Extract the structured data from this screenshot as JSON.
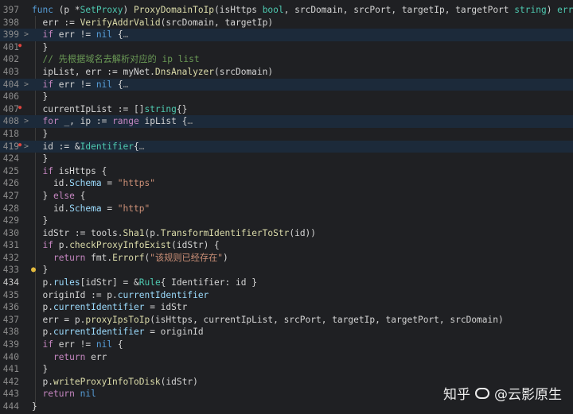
{
  "editor": {
    "lines": [
      {
        "num": "397",
        "fold": "",
        "segments": [
          {
            "t": "func",
            "c": "kw2"
          },
          {
            "t": " (p *",
            "c": "plain"
          },
          {
            "t": "SetProxy",
            "c": "ty"
          },
          {
            "t": ") ",
            "c": "plain"
          },
          {
            "t": "ProxyDomainToIp",
            "c": "fn"
          },
          {
            "t": "(isHttps ",
            "c": "plain"
          },
          {
            "t": "bool",
            "c": "ty"
          },
          {
            "t": ", srcDomain, srcPort, targetIp, targetPort ",
            "c": "plain"
          },
          {
            "t": "string",
            "c": "ty"
          },
          {
            "t": ") ",
            "c": "plain"
          },
          {
            "t": "error",
            "c": "ty"
          },
          {
            "t": " {",
            "c": "plain"
          }
        ]
      },
      {
        "num": "398",
        "fold": "",
        "segments": [
          {
            "t": "  err := ",
            "c": "plain"
          },
          {
            "t": "VerifyAddrValid",
            "c": "fn"
          },
          {
            "t": "(srcDomain, targetIp)",
            "c": "plain"
          }
        ]
      },
      {
        "num": "399",
        "fold": ">",
        "folded": true,
        "segments": [
          {
            "t": "  ",
            "c": "plain"
          },
          {
            "t": "if",
            "c": "kw"
          },
          {
            "t": " err != ",
            "c": "plain"
          },
          {
            "t": "nil",
            "c": "kw2"
          },
          {
            "t": " {",
            "c": "plain"
          },
          {
            "t": "…",
            "c": "fold-ell"
          }
        ]
      },
      {
        "num": "401",
        "fold": "",
        "marker": true,
        "segments": [
          {
            "t": "  }",
            "c": "plain"
          }
        ]
      },
      {
        "num": "402",
        "fold": "",
        "segments": [
          {
            "t": "  // 先根据域名去解析对应的 ip list",
            "c": "cm"
          }
        ]
      },
      {
        "num": "403",
        "fold": "",
        "segments": [
          {
            "t": "  ipList, err := myNet.",
            "c": "plain"
          },
          {
            "t": "DnsAnalyzer",
            "c": "fn"
          },
          {
            "t": "(srcDomain)",
            "c": "plain"
          }
        ]
      },
      {
        "num": "404",
        "fold": ">",
        "folded": true,
        "segments": [
          {
            "t": "  ",
            "c": "plain"
          },
          {
            "t": "if",
            "c": "kw"
          },
          {
            "t": " err != ",
            "c": "plain"
          },
          {
            "t": "nil",
            "c": "kw2"
          },
          {
            "t": " {",
            "c": "plain"
          },
          {
            "t": "…",
            "c": "fold-ell"
          }
        ]
      },
      {
        "num": "406",
        "fold": "",
        "segments": [
          {
            "t": "  }",
            "c": "plain"
          }
        ]
      },
      {
        "num": "407",
        "fold": "",
        "marker": true,
        "segments": [
          {
            "t": "  currentIpList := []",
            "c": "plain"
          },
          {
            "t": "string",
            "c": "ty"
          },
          {
            "t": "{}",
            "c": "plain"
          }
        ]
      },
      {
        "num": "408",
        "fold": ">",
        "folded": true,
        "segments": [
          {
            "t": "  ",
            "c": "plain"
          },
          {
            "t": "for",
            "c": "kw"
          },
          {
            "t": " _, ip := ",
            "c": "plain"
          },
          {
            "t": "range",
            "c": "kw"
          },
          {
            "t": " ipList {",
            "c": "plain"
          },
          {
            "t": "…",
            "c": "fold-ell"
          }
        ]
      },
      {
        "num": "418",
        "fold": "",
        "segments": [
          {
            "t": "  }",
            "c": "plain"
          }
        ]
      },
      {
        "num": "419",
        "fold": ">",
        "folded": true,
        "marker": true,
        "segments": [
          {
            "t": "  id := &",
            "c": "plain"
          },
          {
            "t": "Identifier",
            "c": "ty"
          },
          {
            "t": "{",
            "c": "plain"
          },
          {
            "t": "…",
            "c": "fold-ell"
          }
        ]
      },
      {
        "num": "424",
        "fold": "",
        "segments": [
          {
            "t": "  }",
            "c": "plain"
          }
        ]
      },
      {
        "num": "425",
        "fold": "",
        "segments": [
          {
            "t": "  ",
            "c": "plain"
          },
          {
            "t": "if",
            "c": "kw"
          },
          {
            "t": " isHttps {",
            "c": "plain"
          }
        ]
      },
      {
        "num": "426",
        "fold": "",
        "segments": [
          {
            "t": "    id.",
            "c": "plain"
          },
          {
            "t": "Schema",
            "c": "var"
          },
          {
            "t": " = ",
            "c": "plain"
          },
          {
            "t": "\"https\"",
            "c": "str"
          }
        ]
      },
      {
        "num": "427",
        "fold": "",
        "segments": [
          {
            "t": "  } ",
            "c": "plain"
          },
          {
            "t": "else",
            "c": "kw"
          },
          {
            "t": " {",
            "c": "plain"
          }
        ]
      },
      {
        "num": "428",
        "fold": "",
        "segments": [
          {
            "t": "    id.",
            "c": "plain"
          },
          {
            "t": "Schema",
            "c": "var"
          },
          {
            "t": " = ",
            "c": "plain"
          },
          {
            "t": "\"http\"",
            "c": "str"
          }
        ]
      },
      {
        "num": "429",
        "fold": "",
        "segments": [
          {
            "t": "  }",
            "c": "plain"
          }
        ]
      },
      {
        "num": "430",
        "fold": "",
        "segments": [
          {
            "t": "  idStr := tools.",
            "c": "plain"
          },
          {
            "t": "Sha1",
            "c": "fn"
          },
          {
            "t": "(p.",
            "c": "plain"
          },
          {
            "t": "TransformIdentifierToStr",
            "c": "fn"
          },
          {
            "t": "(id))",
            "c": "plain"
          }
        ]
      },
      {
        "num": "431",
        "fold": "",
        "segments": [
          {
            "t": "  ",
            "c": "plain"
          },
          {
            "t": "if",
            "c": "kw"
          },
          {
            "t": " p.",
            "c": "plain"
          },
          {
            "t": "checkProxyInfoExist",
            "c": "fn"
          },
          {
            "t": "(idStr) {",
            "c": "plain"
          }
        ]
      },
      {
        "num": "432",
        "fold": "",
        "segments": [
          {
            "t": "    ",
            "c": "plain"
          },
          {
            "t": "return",
            "c": "kw"
          },
          {
            "t": " fmt.",
            "c": "plain"
          },
          {
            "t": "Errorf",
            "c": "fn"
          },
          {
            "t": "(",
            "c": "plain"
          },
          {
            "t": "\"该规则已经存在\"",
            "c": "str"
          },
          {
            "t": ")",
            "c": "plain"
          }
        ]
      },
      {
        "num": "433",
        "fold": "",
        "bulb": true,
        "segments": [
          {
            "t": "  }",
            "c": "plain"
          }
        ]
      },
      {
        "num": "434",
        "fold": "",
        "current": true,
        "segments": [
          {
            "t": "  p.",
            "c": "plain"
          },
          {
            "t": "rules",
            "c": "var"
          },
          {
            "t": "[idStr] = &",
            "c": "plain"
          },
          {
            "t": "Rule",
            "c": "ty"
          },
          {
            "t": "{ Identifier: id }",
            "c": "plain"
          }
        ]
      },
      {
        "num": "435",
        "fold": "",
        "segments": [
          {
            "t": "  originId := p.",
            "c": "plain"
          },
          {
            "t": "currentIdentifier",
            "c": "var"
          }
        ]
      },
      {
        "num": "436",
        "fold": "",
        "segments": [
          {
            "t": "  p.",
            "c": "plain"
          },
          {
            "t": "currentIdentifier",
            "c": "var"
          },
          {
            "t": " = idStr",
            "c": "plain"
          }
        ]
      },
      {
        "num": "437",
        "fold": "",
        "segments": [
          {
            "t": "  err = p.",
            "c": "plain"
          },
          {
            "t": "proxyIpsToIp",
            "c": "fn"
          },
          {
            "t": "(isHttps, currentIpList, srcPort, targetIp, targetPort, srcDomain)",
            "c": "plain"
          }
        ]
      },
      {
        "num": "438",
        "fold": "",
        "segments": [
          {
            "t": "  p.",
            "c": "plain"
          },
          {
            "t": "currentIdentifier",
            "c": "var"
          },
          {
            "t": " = originId",
            "c": "plain"
          }
        ]
      },
      {
        "num": "439",
        "fold": "",
        "segments": [
          {
            "t": "  ",
            "c": "plain"
          },
          {
            "t": "if",
            "c": "kw"
          },
          {
            "t": " err != ",
            "c": "plain"
          },
          {
            "t": "nil",
            "c": "kw2"
          },
          {
            "t": " {",
            "c": "plain"
          }
        ]
      },
      {
        "num": "440",
        "fold": "",
        "segments": [
          {
            "t": "    ",
            "c": "plain"
          },
          {
            "t": "return",
            "c": "kw"
          },
          {
            "t": " err",
            "c": "plain"
          }
        ]
      },
      {
        "num": "441",
        "fold": "",
        "segments": [
          {
            "t": "  }",
            "c": "plain"
          }
        ]
      },
      {
        "num": "442",
        "fold": "",
        "segments": [
          {
            "t": "  p.",
            "c": "plain"
          },
          {
            "t": "writeProxyInfoToDisk",
            "c": "fn"
          },
          {
            "t": "(idStr)",
            "c": "plain"
          }
        ]
      },
      {
        "num": "443",
        "fold": "",
        "segments": [
          {
            "t": "  ",
            "c": "plain"
          },
          {
            "t": "return",
            "c": "kw"
          },
          {
            "t": " ",
            "c": "plain"
          },
          {
            "t": "nil",
            "c": "kw2"
          }
        ]
      },
      {
        "num": "444",
        "fold": "",
        "segments": [
          {
            "t": "}",
            "c": "plain"
          }
        ]
      }
    ]
  },
  "watermark": {
    "brand": "知乎",
    "handle": "@云影原生"
  }
}
